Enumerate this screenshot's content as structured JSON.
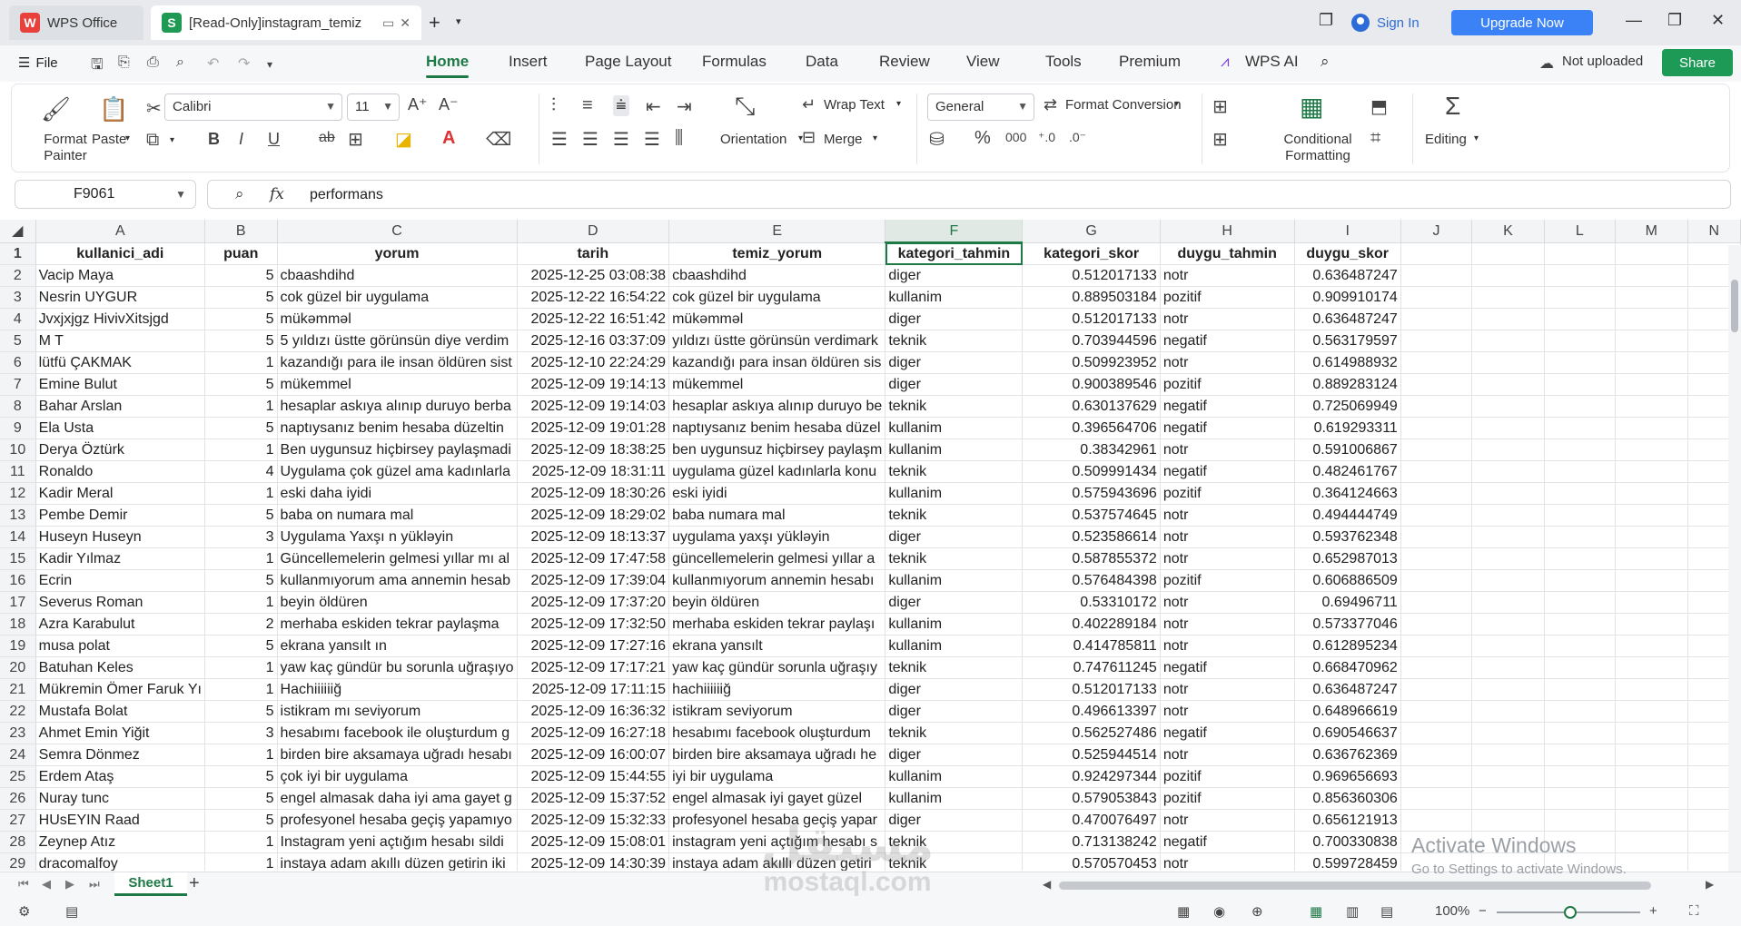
{
  "titlebar": {
    "wps_tab": "WPS Office",
    "doc_tab": "[Read-Only]instagram_temiz",
    "sign_in": "Sign In",
    "upgrade": "Upgrade Now"
  },
  "menu": {
    "file": "File",
    "tabs": [
      "Home",
      "Insert",
      "Page Layout",
      "Formulas",
      "Data",
      "Review",
      "View",
      "Tools",
      "Premium",
      "WPS AI"
    ],
    "not_uploaded": "Not uploaded",
    "share": "Share"
  },
  "ribbon": {
    "format_painter": "Format Painter",
    "paste": "Paste",
    "font_name": "Calibri",
    "font_size": "11",
    "wrap_text": "Wrap Text",
    "orientation": "Orientation",
    "merge": "Merge",
    "number_format": "General",
    "format_conversion": "Format Conversion",
    "conditional_formatting": "Conditional Formatting",
    "editing": "Editing"
  },
  "formula_bar": {
    "cell_ref": "F9061",
    "fx": "fx",
    "value": "performans"
  },
  "grid": {
    "columns": [
      "A",
      "B",
      "C",
      "D",
      "E",
      "F",
      "G",
      "H",
      "I",
      "J",
      "K",
      "L",
      "M",
      "N"
    ],
    "headers": [
      "kullanici_adi",
      "puan",
      "yorum",
      "tarih",
      "temiz_yorum",
      "kategori_tahmin",
      "kategori_skor",
      "duygu_tahmin",
      "duygu_skor"
    ],
    "rows": [
      [
        "Vacip Maya",
        "5",
        "cbaashdihd",
        "2025-12-25 03:08:38",
        "cbaashdihd",
        "diger",
        "0.512017133",
        "notr",
        "0.636487247"
      ],
      [
        "Nesrin UYGUR",
        "5",
        "cok güzel bir uygulama",
        "2025-12-22 16:54:22",
        "cok güzel bir uygulama",
        "kullanim",
        "0.889503184",
        "pozitif",
        "0.909910174"
      ],
      [
        "Jvxjxjgz HivivXitsjgd",
        "5",
        "mükəmməl",
        "2025-12-22 16:51:42",
        "mükəmməl",
        "diger",
        "0.512017133",
        "notr",
        "0.636487247"
      ],
      [
        "M T",
        "5",
        "5 yıldızı üstte görünsün diye verdim",
        "2025-12-16 03:37:09",
        "yıldızı üstte görünsün verdimark",
        "teknik",
        "0.703944596",
        "negatif",
        "0.563179597"
      ],
      [
        "lütfü ÇAKMAK",
        "1",
        "kazandığı para ile insan öldüren sist",
        "2025-12-10 22:24:29",
        "kazandığı para insan öldüren sis",
        "diger",
        "0.509923952",
        "notr",
        "0.614988932"
      ],
      [
        "Emine Bulut",
        "5",
        "mükemmel",
        "2025-12-09 19:14:13",
        "mükemmel",
        "diger",
        "0.900389546",
        "pozitif",
        "0.889283124"
      ],
      [
        "Bahar Arslan",
        "1",
        "hesaplar askıya alınıp duruyo berba",
        "2025-12-09 19:14:03",
        "hesaplar askıya alınıp duruyo be",
        "teknik",
        "0.630137629",
        "negatif",
        "0.725069949"
      ],
      [
        "Ela Usta",
        "5",
        "naptıysanız benim hesaba düzeltin",
        "2025-12-09 19:01:28",
        "naptıysanız benim hesaba düzel",
        "kullanim",
        "0.396564706",
        "negatif",
        "0.619293311"
      ],
      [
        "Derya Öztürk",
        "1",
        "Ben uygunsuz hiçbirsey paylaşmadi",
        "2025-12-09 18:38:25",
        "ben uygunsuz hiçbirsey paylaşm",
        "kullanim",
        "0.38342961",
        "notr",
        "0.591006867"
      ],
      [
        "Ronaldo",
        "4",
        "Uygulama çok güzel ama kadınlarla",
        "2025-12-09 18:31:11",
        "uygulama güzel kadınlarla konu",
        "teknik",
        "0.509991434",
        "negatif",
        "0.482461767"
      ],
      [
        "Kadir Meral",
        "1",
        "eski daha iyidi",
        "2025-12-09 18:30:26",
        "eski iyidi",
        "kullanim",
        "0.575943696",
        "pozitif",
        "0.364124663"
      ],
      [
        "Pembe Demir",
        "5",
        "baba on numara mal",
        "2025-12-09 18:29:02",
        "baba numara mal",
        "teknik",
        "0.537574645",
        "notr",
        "0.494444749"
      ],
      [
        "Huseyn Huseyn",
        "3",
        "Uygulama Yaxşı n yükləyin",
        "2025-12-09 18:13:37",
        "uygulama yaxşı yükləyin",
        "diger",
        "0.523586614",
        "notr",
        "0.593762348"
      ],
      [
        "Kadir Yılmaz",
        "1",
        "Güncellemelerin gelmesi yıllar mı al",
        "2025-12-09 17:47:58",
        "güncellemelerin gelmesi yıllar a",
        "teknik",
        "0.587855372",
        "notr",
        "0.652987013"
      ],
      [
        "Ecrin",
        "5",
        "kullanmıyorum ama annemin hesab",
        "2025-12-09 17:39:04",
        "kullanmıyorum annemin hesabı",
        "kullanim",
        "0.576484398",
        "pozitif",
        "0.606886509"
      ],
      [
        "Severus Roman",
        "1",
        "beyin öldüren",
        "2025-12-09 17:37:20",
        "beyin öldüren",
        "diger",
        "0.53310172",
        "notr",
        "0.69496711"
      ],
      [
        "Azra Karabulut",
        "2",
        "merhaba eskiden tekrar paylaşma",
        "2025-12-09 17:32:50",
        "merhaba eskiden tekrar paylaşı",
        "kullanim",
        "0.402289184",
        "notr",
        "0.573377046"
      ],
      [
        "musa polat",
        "5",
        "ekrana yansılt ın",
        "2025-12-09 17:27:16",
        "ekrana yansılt",
        "kullanim",
        "0.414785811",
        "notr",
        "0.612895234"
      ],
      [
        "Batuhan Keles",
        "1",
        "yaw kaç gündür bu sorunla uğraşıyo",
        "2025-12-09 17:17:21",
        "yaw kaç gündür sorunla uğraşıy",
        "teknik",
        "0.747611245",
        "negatif",
        "0.668470962"
      ],
      [
        "Mükremin Ömer Faruk Yı",
        "1",
        "Hachiiiiiiğ",
        "2025-12-09 17:11:15",
        "hachiiiiiiğ",
        "diger",
        "0.512017133",
        "notr",
        "0.636487247"
      ],
      [
        "Mustafa Bolat",
        "5",
        "istikram mı seviyorum",
        "2025-12-09 16:36:32",
        "istikram seviyorum",
        "diger",
        "0.496613397",
        "notr",
        "0.648966619"
      ],
      [
        "Ahmet Emin Yiğit",
        "3",
        "hesabımı facebook ile oluşturdum g",
        "2025-12-09 16:27:18",
        "hesabımı facebook oluşturdum",
        "teknik",
        "0.562527486",
        "negatif",
        "0.690546637"
      ],
      [
        "Semra Dönmez",
        "1",
        "birden bire aksamaya uğradı hesabı",
        "2025-12-09 16:00:07",
        "birden bire aksamaya uğradı he",
        "diger",
        "0.525944514",
        "notr",
        "0.636762369"
      ],
      [
        "Erdem Ataş",
        "5",
        "çok iyi bir uygulama",
        "2025-12-09 15:44:55",
        "iyi bir uygulama",
        "kullanim",
        "0.924297344",
        "pozitif",
        "0.969656693"
      ],
      [
        "Nuray tunc",
        "5",
        "engel almasak daha iyi ama gayet g",
        "2025-12-09 15:37:52",
        "engel almasak iyi gayet güzel",
        "kullanim",
        "0.579053843",
        "pozitif",
        "0.856360306"
      ],
      [
        "HUsEYIN Raad",
        "5",
        "profesyonel hesaba geçiş yapamıyo",
        "2025-12-09 15:32:33",
        "profesyonel hesaba geçiş yapar",
        "diger",
        "0.470076497",
        "notr",
        "0.656121913"
      ],
      [
        "Zeynep Atız",
        "1",
        "Instagram yeni açtığım hesabı sildi",
        "2025-12-09 15:08:01",
        "instagram yeni açtığım hesabı s",
        "teknik",
        "0.713138242",
        "negatif",
        "0.700330838"
      ],
      [
        "dracomalfoy",
        "1",
        "instaya adam akıllı düzen getirin iki",
        "2025-12-09 14:30:39",
        "instaya adam akıllı düzen getiri",
        "teknik",
        "0.570570453",
        "notr",
        "0.599728459"
      ]
    ]
  },
  "sheets": {
    "active": "Sheet1"
  },
  "status": {
    "zoom": "100%"
  },
  "overlays": {
    "activate_title": "Activate Windows",
    "activate_sub": "Go to Settings to activate Windows.",
    "watermark_ar": "مستقل",
    "watermark_en": "mostaql.com"
  },
  "colors": {
    "accent": "#1d7a46",
    "upgrade": "#3b82f6",
    "share": "#1d9a55"
  }
}
